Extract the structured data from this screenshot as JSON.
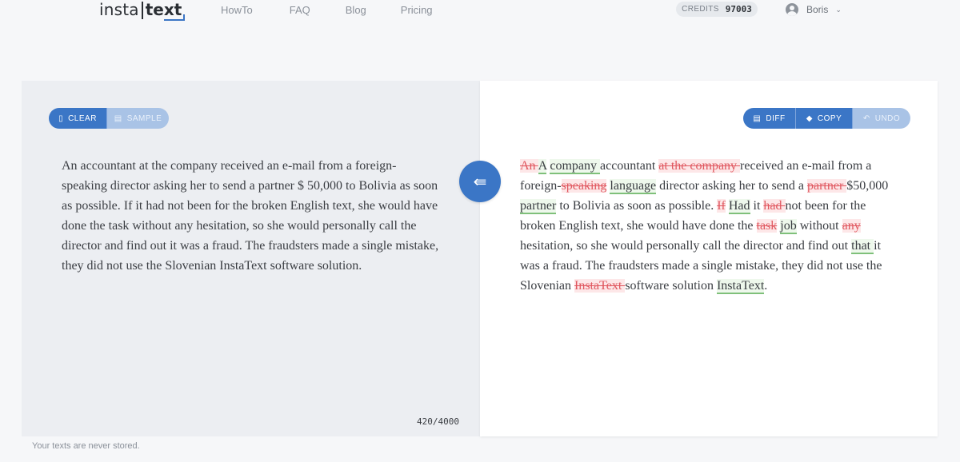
{
  "header": {
    "logo_part1": "insta",
    "logo_part2": "text",
    "nav": [
      "HowTo",
      "FAQ",
      "Blog",
      "Pricing"
    ],
    "credits_label": "CREDITS",
    "credits_value": "97003",
    "user_name": "Boris"
  },
  "left_panel": {
    "clear_label": "CLEAR",
    "sample_label": "SAMPLE",
    "text": "An accountant at the company received an e-mail from a foreign-speaking director asking her to send a partner $ 50,000 to Bolivia as soon as possible. If it had not been for the broken English text, she would have done the task without any hesitation, so she would personally call the director and find out it was a fraud. The fraudsters made a single mistake, they did not use the Slovenian InstaText software solution.",
    "counter": "420/4000"
  },
  "right_panel": {
    "diff_label": "DIFF",
    "copy_label": "COPY",
    "undo_label": "UNDO",
    "segments": [
      {
        "t": "del",
        "v": "An "
      },
      {
        "t": "ins",
        "v": "A"
      },
      {
        "t": "txt",
        "v": " "
      },
      {
        "t": "ins",
        "v": "company "
      },
      {
        "t": "txt",
        "v": "accountant "
      },
      {
        "t": "del",
        "v": "at the company "
      },
      {
        "t": "txt",
        "v": " received an e-mail from a foreign-"
      },
      {
        "t": "del",
        "v": "speaking"
      },
      {
        "t": "txt",
        "v": " "
      },
      {
        "t": "ins",
        "v": "language"
      },
      {
        "t": "txt",
        "v": " director asking her to send a "
      },
      {
        "t": "del",
        "v": "partner "
      },
      {
        "t": "txt",
        "v": " $50,000 "
      },
      {
        "t": "ins",
        "v": "partner"
      },
      {
        "t": "txt",
        "v": " to Bolivia as soon as possible. "
      },
      {
        "t": "del",
        "v": "If"
      },
      {
        "t": "txt",
        "v": " "
      },
      {
        "t": "ins",
        "v": "Had"
      },
      {
        "t": "txt",
        "v": " it "
      },
      {
        "t": "del",
        "v": "had "
      },
      {
        "t": "txt",
        "v": " not been for the broken English text, she would have done the "
      },
      {
        "t": "del",
        "v": "task"
      },
      {
        "t": "txt",
        "v": " "
      },
      {
        "t": "ins",
        "v": "job"
      },
      {
        "t": "txt",
        "v": " without "
      },
      {
        "t": "del",
        "v": "any "
      },
      {
        "t": "txt",
        "v": " hesitation, so she would personally call the director and find out "
      },
      {
        "t": "ins",
        "v": "that "
      },
      {
        "t": "txt",
        "v": "it was a fraud. The fraudsters made a single mistake, they did not use the Slovenian "
      },
      {
        "t": "del",
        "v": "InstaText "
      },
      {
        "t": "txt",
        "v": " software solution "
      },
      {
        "t": "ins",
        "v": "InstaText"
      },
      {
        "t": "txt",
        "v": "."
      }
    ]
  },
  "footer": {
    "note": "Your texts are never stored."
  },
  "colors": {
    "accent": "#3b76c6",
    "deleted": "#e0575f",
    "inserted": "#7fc07a"
  }
}
